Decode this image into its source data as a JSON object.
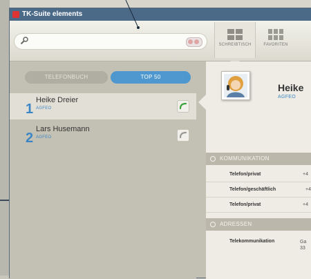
{
  "window": {
    "title": "TK-Suite elements"
  },
  "search": {
    "placeholder": "",
    "value": ""
  },
  "views": [
    {
      "label": "SCHREIBTISCH",
      "icon": "desk-grid-icon"
    },
    {
      "label": "FAVORITEN",
      "icon": "favorites-grid-icon"
    }
  ],
  "tabs": {
    "phonebook": "TELEFONBUCH",
    "top50": "TOP 50"
  },
  "contacts": [
    {
      "rank": "1",
      "name": "Heike Dreier",
      "company": "AGFEO",
      "call_icon": "phone-active-icon"
    },
    {
      "rank": "2",
      "name": "Lars Husemann",
      "company": "AGFEO",
      "call_icon": "phone-inactive-icon"
    }
  ],
  "detail": {
    "name": "Heike",
    "company": "AGFEO",
    "communication_header": "KOMMUNIKATION",
    "communication": [
      {
        "label": "Telefon/privat",
        "value": "+4"
      },
      {
        "label": "Telefon/geschäftlich",
        "value": "+4"
      },
      {
        "label": "Telefon/privat",
        "value": "+4"
      }
    ],
    "address_header": "ADRESSEN",
    "address": {
      "label": "Telekommunikation",
      "line1": "Ga",
      "line2": "33"
    }
  },
  "colors": {
    "accent": "#3d86c5",
    "titlebar": "#4b6a88",
    "tab_active": "#4f97cf"
  }
}
